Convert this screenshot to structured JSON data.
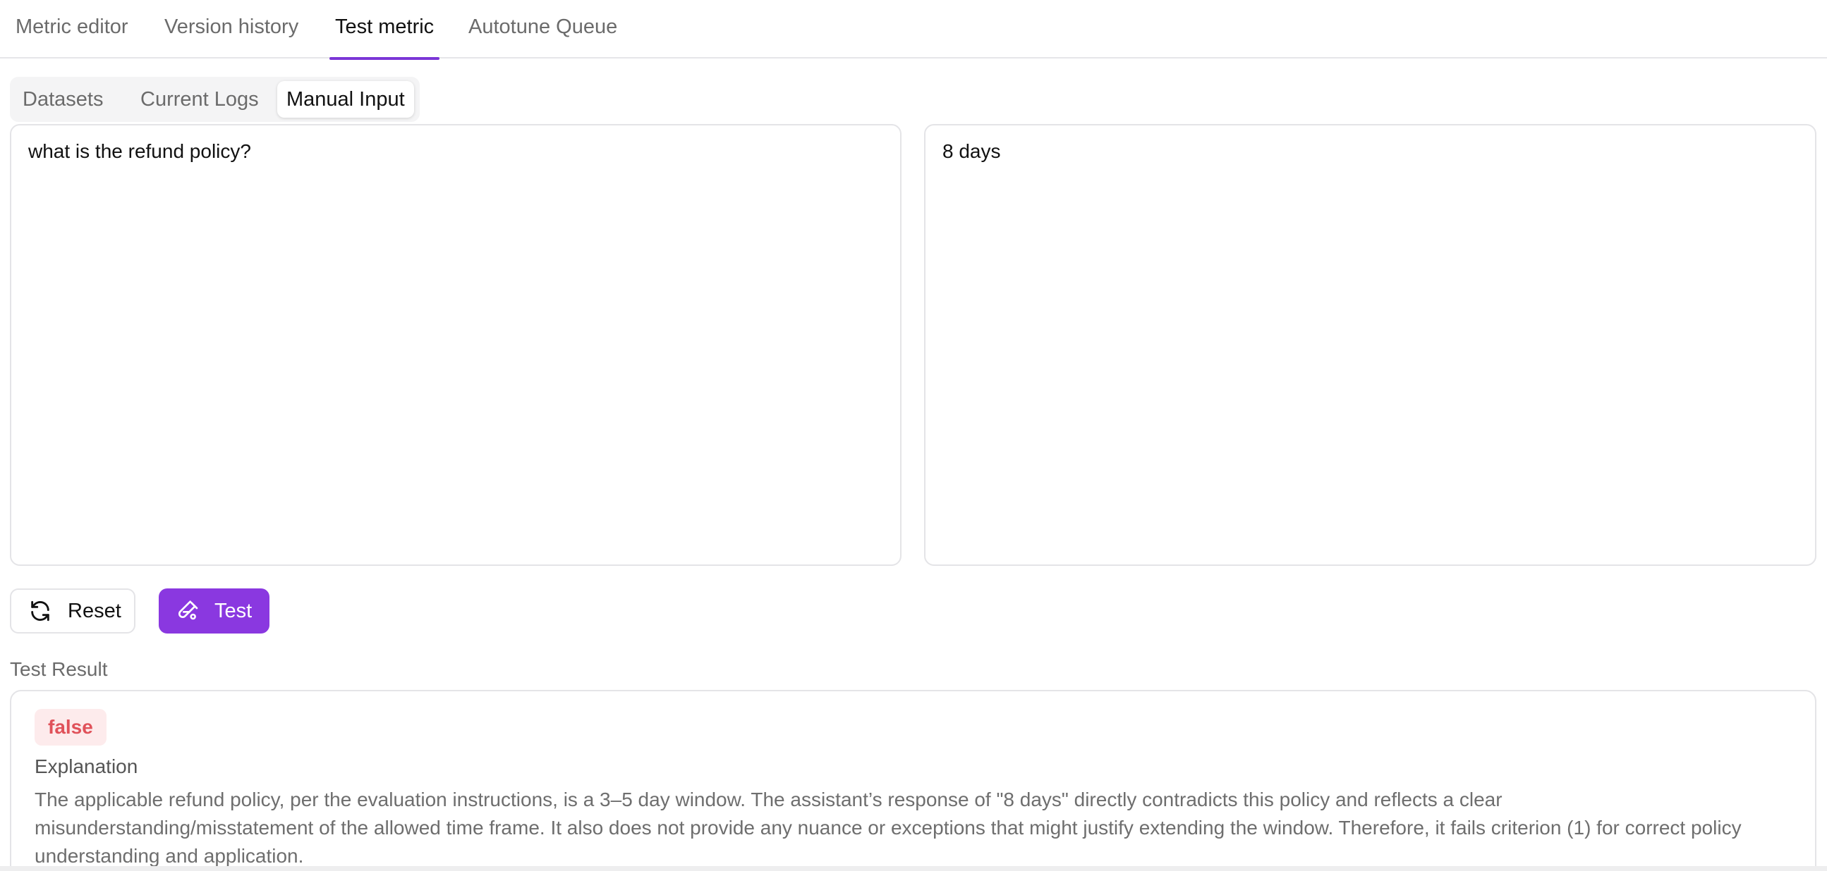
{
  "top_tabs": {
    "metric_editor": "Metric editor",
    "version_history": "Version history",
    "test_metric": "Test metric",
    "autotune_queue": "Autotune Queue",
    "active": "test_metric"
  },
  "sub_tabs": {
    "datasets": "Datasets",
    "current_logs": "Current Logs",
    "manual_input": "Manual Input",
    "active": "manual_input"
  },
  "manual_input": {
    "input_value": "what is the refund policy?",
    "output_value": "8 days"
  },
  "actions": {
    "reset_label": "Reset",
    "test_label": "Test",
    "test_color": "#8a38e0"
  },
  "result": {
    "label": "Test Result",
    "value": "false",
    "value_color": "#e0525a",
    "explanation_label": "Explanation",
    "explanation": "The applicable refund policy, per the evaluation instructions, is a 3–5 day window. The assistant’s response of \"8 days\" directly contradicts this policy and reflects a clear misunderstanding/misstatement of the allowed time frame. It also does not provide any nuance or exceptions that might justify extending the window. Therefore, it fails criterion (1) for correct policy understanding and application."
  },
  "icons": {
    "reset": "refresh-icon",
    "test": "flask-icon"
  },
  "accent_color": "#7b36d6"
}
